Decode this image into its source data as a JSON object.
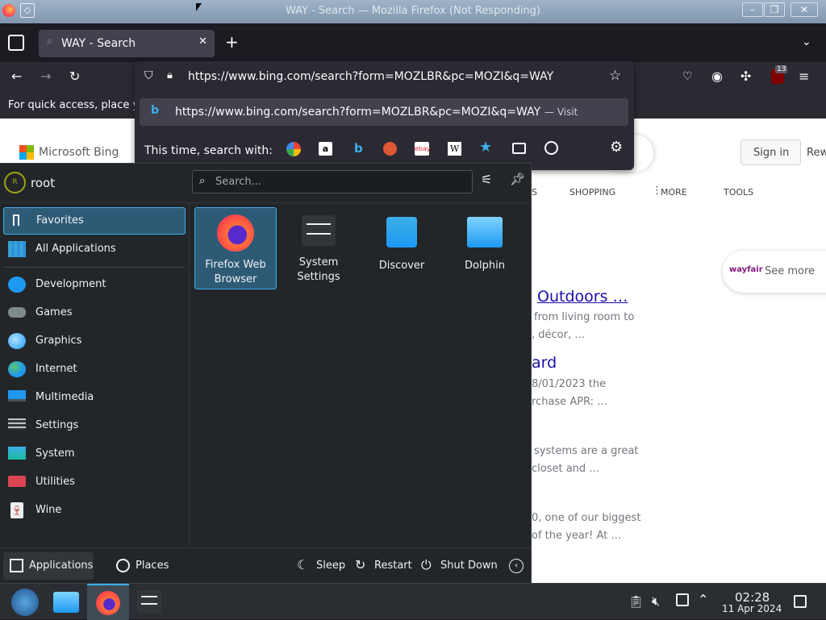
{
  "window": {
    "title": "WAY - Search — Mozilla Firefox (Not Responding)"
  },
  "tab": {
    "label": "WAY - Search"
  },
  "urlbar": {
    "url": "https://www.bing.com/search?form=MOZLBR&pc=MOZI&q=WAY"
  },
  "dropdown": {
    "suggestion_url": "https://www.bing.com/search?form=MOZLBR&pc=MOZI&q=WAY",
    "suggestion_action": "— Visit",
    "search_with_label": "This time, search with:",
    "engines": [
      "google-icon",
      "amazon-icon",
      "bing-icon",
      "duckduckgo-icon",
      "ebay-icon",
      "wikipedia-icon",
      "bookmarks-star-icon",
      "tabs-icon",
      "history-icon"
    ]
  },
  "bookmark_bar": {
    "text": "For quick access, place y"
  },
  "toolbar": {
    "extension_badge": "13"
  },
  "bing": {
    "logo_text": "Microsoft Bing",
    "signin": "Sign in",
    "rewards": "Rew",
    "nav": [
      "S",
      "SHOPPING",
      "MORE",
      "TOOLS"
    ],
    "wayfair_logo": "wayfair",
    "see_more": "See more",
    "results": [
      {
        "title": "Outdoors …",
        "lines": [
          "from living room to",
          ", décor, …"
        ]
      },
      {
        "title": "ard",
        "lines": [
          "8/01/2023 the",
          "rchase APR: …"
        ]
      },
      {
        "title": "",
        "lines": [
          "systems are a great",
          "closet and …"
        ]
      },
      {
        "title": "",
        "lines": [
          "0, one of our biggest",
          "of the year! At …"
        ]
      }
    ]
  },
  "menu": {
    "user": "root",
    "avatar_letter": "R",
    "search_placeholder": "Search...",
    "categories": [
      {
        "label": "Favorites",
        "icon": "bookmark-icon"
      },
      {
        "label": "All Applications",
        "icon": "grid-icon"
      },
      {
        "label": "Development",
        "icon": "development-icon"
      },
      {
        "label": "Games",
        "icon": "gamepad-icon"
      },
      {
        "label": "Graphics",
        "icon": "graphics-icon"
      },
      {
        "label": "Internet",
        "icon": "globe-icon"
      },
      {
        "label": "Multimedia",
        "icon": "multimedia-icon"
      },
      {
        "label": "Settings",
        "icon": "settings-icon"
      },
      {
        "label": "System",
        "icon": "system-icon"
      },
      {
        "label": "Utilities",
        "icon": "utilities-icon"
      },
      {
        "label": "Wine",
        "icon": "wine-icon"
      }
    ],
    "apps": [
      {
        "label": "Firefox Web Browser",
        "icon": "firefox-icon"
      },
      {
        "label": "System Settings",
        "icon": "system-settings-icon"
      },
      {
        "label": "Discover",
        "icon": "discover-icon"
      },
      {
        "label": "Dolphin",
        "icon": "folder-icon"
      }
    ],
    "footer": {
      "applications": "Applications",
      "places": "Places",
      "sleep": "Sleep",
      "restart": "Restart",
      "shutdown": "Shut Down"
    }
  },
  "taskbar": {
    "time": "02:28",
    "date": "11 Apr 2024"
  },
  "colors": {
    "accent": "#3daee9",
    "selection": "#2d5b76",
    "bing_link": "#1a0dab",
    "firefox_orange": "#ff7139"
  }
}
